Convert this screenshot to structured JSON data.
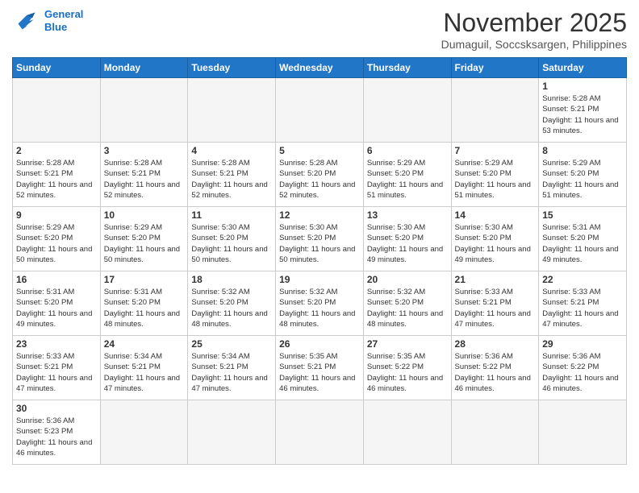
{
  "header": {
    "logo_line1": "General",
    "logo_line2": "Blue",
    "month_title": "November 2025",
    "location": "Dumaguil, Soccsksargen, Philippines"
  },
  "days_of_week": [
    "Sunday",
    "Monday",
    "Tuesday",
    "Wednesday",
    "Thursday",
    "Friday",
    "Saturday"
  ],
  "weeks": [
    [
      {
        "num": "",
        "info": ""
      },
      {
        "num": "",
        "info": ""
      },
      {
        "num": "",
        "info": ""
      },
      {
        "num": "",
        "info": ""
      },
      {
        "num": "",
        "info": ""
      },
      {
        "num": "",
        "info": ""
      },
      {
        "num": "1",
        "info": "Sunrise: 5:28 AM\nSunset: 5:21 PM\nDaylight: 11 hours\nand 53 minutes."
      }
    ],
    [
      {
        "num": "2",
        "info": "Sunrise: 5:28 AM\nSunset: 5:21 PM\nDaylight: 11 hours\nand 52 minutes."
      },
      {
        "num": "3",
        "info": "Sunrise: 5:28 AM\nSunset: 5:21 PM\nDaylight: 11 hours\nand 52 minutes."
      },
      {
        "num": "4",
        "info": "Sunrise: 5:28 AM\nSunset: 5:21 PM\nDaylight: 11 hours\nand 52 minutes."
      },
      {
        "num": "5",
        "info": "Sunrise: 5:28 AM\nSunset: 5:20 PM\nDaylight: 11 hours\nand 52 minutes."
      },
      {
        "num": "6",
        "info": "Sunrise: 5:29 AM\nSunset: 5:20 PM\nDaylight: 11 hours\nand 51 minutes."
      },
      {
        "num": "7",
        "info": "Sunrise: 5:29 AM\nSunset: 5:20 PM\nDaylight: 11 hours\nand 51 minutes."
      },
      {
        "num": "8",
        "info": "Sunrise: 5:29 AM\nSunset: 5:20 PM\nDaylight: 11 hours\nand 51 minutes."
      }
    ],
    [
      {
        "num": "9",
        "info": "Sunrise: 5:29 AM\nSunset: 5:20 PM\nDaylight: 11 hours\nand 50 minutes."
      },
      {
        "num": "10",
        "info": "Sunrise: 5:29 AM\nSunset: 5:20 PM\nDaylight: 11 hours\nand 50 minutes."
      },
      {
        "num": "11",
        "info": "Sunrise: 5:30 AM\nSunset: 5:20 PM\nDaylight: 11 hours\nand 50 minutes."
      },
      {
        "num": "12",
        "info": "Sunrise: 5:30 AM\nSunset: 5:20 PM\nDaylight: 11 hours\nand 50 minutes."
      },
      {
        "num": "13",
        "info": "Sunrise: 5:30 AM\nSunset: 5:20 PM\nDaylight: 11 hours\nand 49 minutes."
      },
      {
        "num": "14",
        "info": "Sunrise: 5:30 AM\nSunset: 5:20 PM\nDaylight: 11 hours\nand 49 minutes."
      },
      {
        "num": "15",
        "info": "Sunrise: 5:31 AM\nSunset: 5:20 PM\nDaylight: 11 hours\nand 49 minutes."
      }
    ],
    [
      {
        "num": "16",
        "info": "Sunrise: 5:31 AM\nSunset: 5:20 PM\nDaylight: 11 hours\nand 49 minutes."
      },
      {
        "num": "17",
        "info": "Sunrise: 5:31 AM\nSunset: 5:20 PM\nDaylight: 11 hours\nand 48 minutes."
      },
      {
        "num": "18",
        "info": "Sunrise: 5:32 AM\nSunset: 5:20 PM\nDaylight: 11 hours\nand 48 minutes."
      },
      {
        "num": "19",
        "info": "Sunrise: 5:32 AM\nSunset: 5:20 PM\nDaylight: 11 hours\nand 48 minutes."
      },
      {
        "num": "20",
        "info": "Sunrise: 5:32 AM\nSunset: 5:20 PM\nDaylight: 11 hours\nand 48 minutes."
      },
      {
        "num": "21",
        "info": "Sunrise: 5:33 AM\nSunset: 5:21 PM\nDaylight: 11 hours\nand 47 minutes."
      },
      {
        "num": "22",
        "info": "Sunrise: 5:33 AM\nSunset: 5:21 PM\nDaylight: 11 hours\nand 47 minutes."
      }
    ],
    [
      {
        "num": "23",
        "info": "Sunrise: 5:33 AM\nSunset: 5:21 PM\nDaylight: 11 hours\nand 47 minutes."
      },
      {
        "num": "24",
        "info": "Sunrise: 5:34 AM\nSunset: 5:21 PM\nDaylight: 11 hours\nand 47 minutes."
      },
      {
        "num": "25",
        "info": "Sunrise: 5:34 AM\nSunset: 5:21 PM\nDaylight: 11 hours\nand 47 minutes."
      },
      {
        "num": "26",
        "info": "Sunrise: 5:35 AM\nSunset: 5:21 PM\nDaylight: 11 hours\nand 46 minutes."
      },
      {
        "num": "27",
        "info": "Sunrise: 5:35 AM\nSunset: 5:22 PM\nDaylight: 11 hours\nand 46 minutes."
      },
      {
        "num": "28",
        "info": "Sunrise: 5:36 AM\nSunset: 5:22 PM\nDaylight: 11 hours\nand 46 minutes."
      },
      {
        "num": "29",
        "info": "Sunrise: 5:36 AM\nSunset: 5:22 PM\nDaylight: 11 hours\nand 46 minutes."
      }
    ],
    [
      {
        "num": "30",
        "info": "Sunrise: 5:36 AM\nSunset: 5:23 PM\nDaylight: 11 hours\nand 46 minutes."
      },
      {
        "num": "",
        "info": ""
      },
      {
        "num": "",
        "info": ""
      },
      {
        "num": "",
        "info": ""
      },
      {
        "num": "",
        "info": ""
      },
      {
        "num": "",
        "info": ""
      },
      {
        "num": "",
        "info": ""
      }
    ]
  ]
}
